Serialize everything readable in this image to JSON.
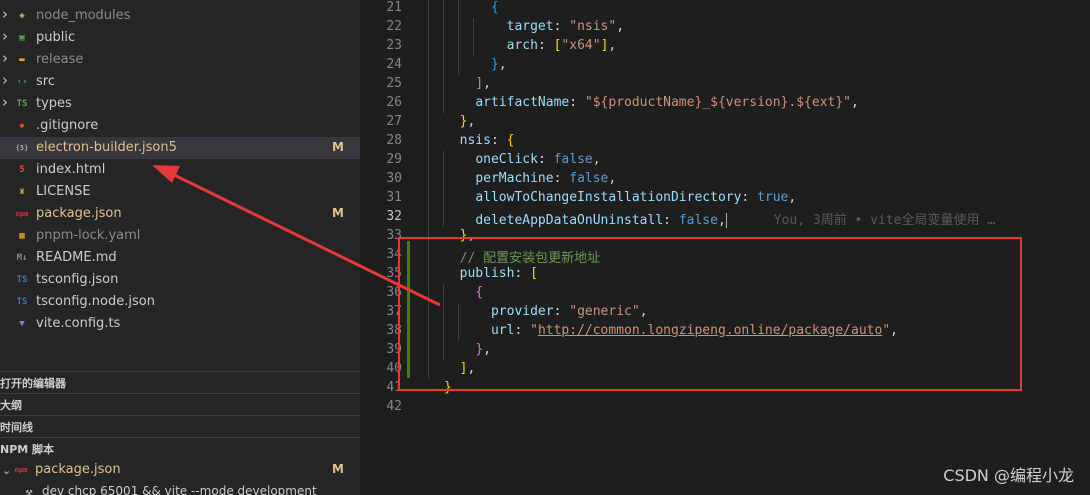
{
  "explorer": {
    "items": [
      {
        "name": "node_modules",
        "chevron": true,
        "icon": "folder-node-icon",
        "icon_glyph": "◆",
        "icon_color": "#8bc34a",
        "dim": true,
        "badge": ""
      },
      {
        "name": "public",
        "chevron": true,
        "icon": "folder-public-icon",
        "icon_glyph": "▣",
        "icon_color": "#4caf50",
        "dim": false,
        "badge": ""
      },
      {
        "name": "release",
        "chevron": true,
        "icon": "folder-icon",
        "icon_glyph": "▬",
        "icon_color": "#e8a13a",
        "dim": true,
        "badge": ""
      },
      {
        "name": "src",
        "chevron": true,
        "icon": "folder-src-icon",
        "icon_glyph": "‹›",
        "icon_color": "#4caf50",
        "dim": false,
        "badge": ""
      },
      {
        "name": "types",
        "chevron": true,
        "icon": "folder-types-icon",
        "icon_glyph": "TS",
        "icon_color": "#4caf50",
        "dim": false,
        "badge": ""
      },
      {
        "name": ".gitignore",
        "chevron": false,
        "icon": "git-icon",
        "icon_glyph": "◆",
        "icon_color": "#e64a19",
        "dim": false,
        "badge": ""
      },
      {
        "name": "electron-builder.json5",
        "chevron": false,
        "icon": "json5-icon",
        "icon_glyph": "{5}",
        "icon_color": "#aaaaaa",
        "dim": false,
        "badge": "M",
        "selected": true,
        "modified": true
      },
      {
        "name": "index.html",
        "chevron": false,
        "icon": "html-icon",
        "icon_glyph": "5",
        "icon_color": "#e44d26",
        "dim": false,
        "badge": ""
      },
      {
        "name": "LICENSE",
        "chevron": false,
        "icon": "license-icon",
        "icon_glyph": "♜",
        "icon_color": "#e8a13a",
        "dim": false,
        "badge": ""
      },
      {
        "name": "package.json",
        "chevron": false,
        "icon": "npm-icon",
        "icon_glyph": "npm",
        "icon_color": "#cb3837",
        "dim": false,
        "badge": "M",
        "modified": true
      },
      {
        "name": "pnpm-lock.yaml",
        "chevron": false,
        "icon": "pnpm-icon",
        "icon_glyph": "▦",
        "icon_color": "#f9ad00",
        "dim": true,
        "badge": ""
      },
      {
        "name": "README.md",
        "chevron": false,
        "icon": "markdown-icon",
        "icon_glyph": "M↓",
        "icon_color": "#888888",
        "dim": false,
        "badge": ""
      },
      {
        "name": "tsconfig.json",
        "chevron": false,
        "icon": "tsconfig-icon",
        "icon_glyph": "TS",
        "icon_color": "#3178c6",
        "dim": false,
        "badge": ""
      },
      {
        "name": "tsconfig.node.json",
        "chevron": false,
        "icon": "tsconfig-icon",
        "icon_glyph": "TS",
        "icon_color": "#3178c6",
        "dim": false,
        "badge": ""
      },
      {
        "name": "vite.config.ts",
        "chevron": false,
        "icon": "vite-icon",
        "icon_glyph": "▼",
        "icon_color": "#a96bff",
        "dim": false,
        "badge": ""
      }
    ]
  },
  "sections": {
    "open_editors": "打开的编辑器",
    "outline": "大纲",
    "timeline": "时间线",
    "npm_scripts": "NPM 脚本"
  },
  "npm_scripts": {
    "file": "package.json",
    "file_badge": "M",
    "script": "dev  chcp 65001 && vite --mode development"
  },
  "editor": {
    "active_line": 32,
    "blame": "You, 3周前 • vite全局变量使用 …",
    "line_numbers": [
      21,
      22,
      23,
      24,
      25,
      26,
      27,
      28,
      29,
      30,
      31,
      32,
      33,
      34,
      35,
      36,
      37,
      38,
      39,
      40,
      41,
      42
    ]
  },
  "watermark": "CSDN @编程小龙",
  "colors": {
    "annotation_red": "#e53935",
    "git_added": "#487e02"
  }
}
